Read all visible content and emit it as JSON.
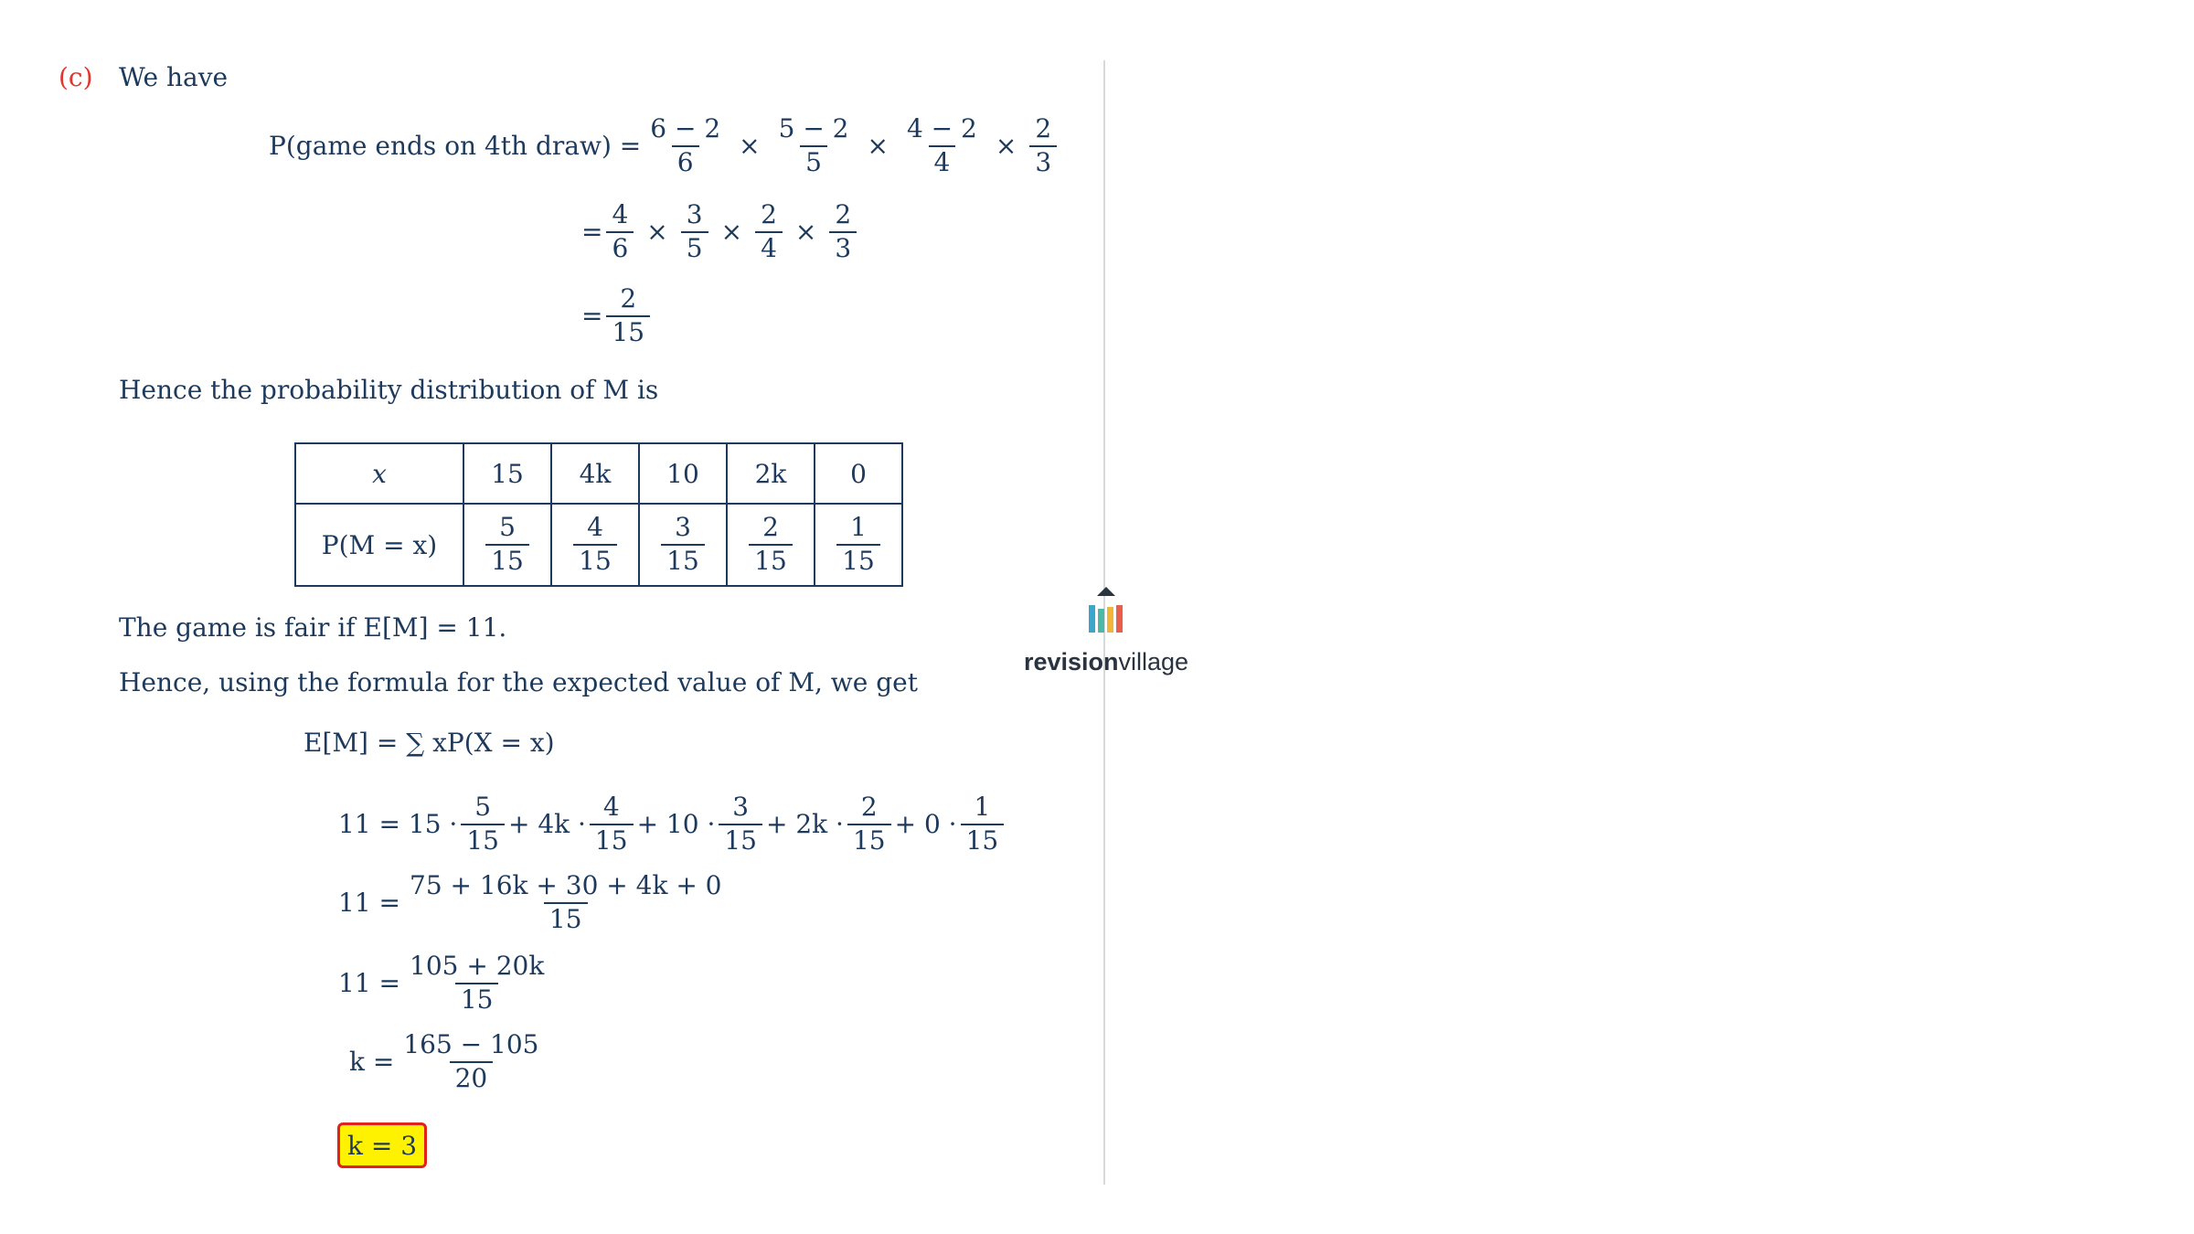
{
  "part": {
    "label": "(c)",
    "intro": "We have"
  },
  "p4": {
    "lhs": "P(game ends on 4th draw) =",
    "f1": {
      "n": "6 − 2",
      "d": "6"
    },
    "f2": {
      "n": "5 − 2",
      "d": "5"
    },
    "f3": {
      "n": "4 − 2",
      "d": "4"
    },
    "f4": {
      "n": "2",
      "d": "3"
    },
    "step2": [
      {
        "n": "4",
        "d": "6"
      },
      {
        "n": "3",
        "d": "5"
      },
      {
        "n": "2",
        "d": "4"
      },
      {
        "n": "2",
        "d": "3"
      }
    ],
    "result": {
      "n": "2",
      "d": "15"
    },
    "times": "×",
    "eq": "="
  },
  "dist_intro": "Hence the probability distribution of M is",
  "table": {
    "header_label": "x",
    "prob_label": "P(M = x)",
    "values": [
      "15",
      "4k",
      "10",
      "2k",
      "0"
    ],
    "probs": [
      {
        "n": "5",
        "d": "15"
      },
      {
        "n": "4",
        "d": "15"
      },
      {
        "n": "3",
        "d": "15"
      },
      {
        "n": "2",
        "d": "15"
      },
      {
        "n": "1",
        "d": "15"
      }
    ]
  },
  "fair_text": "The game is fair if E[M] = 11.",
  "hence_text": "Hence, using the formula for the expected value of M, we get",
  "ev": {
    "formula": "E[M] = ∑ xP(X = x)",
    "line1_lhs": "11 = 15 ·",
    "line1_parts": [
      "+ 4k ·",
      "+ 10 ·",
      "+ 2k ·",
      "+ 0 ·"
    ],
    "line1_fracs": [
      {
        "n": "5",
        "d": "15"
      },
      {
        "n": "4",
        "d": "15"
      },
      {
        "n": "3",
        "d": "15"
      },
      {
        "n": "2",
        "d": "15"
      },
      {
        "n": "1",
        "d": "15"
      }
    ],
    "line2_lhs": "11 =",
    "line2_frac": {
      "n": "75 + 16k + 30 + 4k + 0",
      "d": "15"
    },
    "line3_lhs": "11 =",
    "line3_frac": {
      "n": "105 + 20k",
      "d": "15"
    },
    "line4_lhs": "k =",
    "line4_frac": {
      "n": "165 − 105",
      "d": "20"
    },
    "answer": "k = 3"
  },
  "brand": {
    "bold": "revision",
    "light": "village",
    "colors": [
      "#3aa6c9",
      "#4cb8a8",
      "#f2b53a",
      "#e8604c"
    ]
  }
}
